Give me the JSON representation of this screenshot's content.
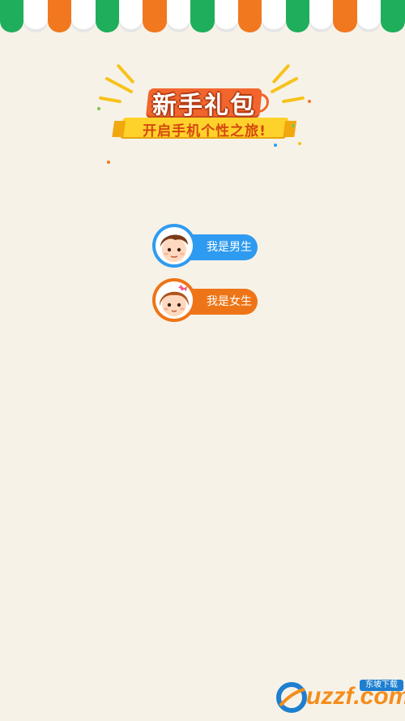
{
  "banner": {
    "title": "新手礼包",
    "subtitle": "开启手机个性之旅!"
  },
  "gender_options": [
    {
      "label": "我是男生",
      "color": "#2f9bf0"
    },
    {
      "label": "我是女生",
      "color": "#ee7517"
    }
  ],
  "footer": {
    "logo_text": "uzzf.com",
    "logo_tag": "东坡下载"
  },
  "colors": {
    "background": "#f7f2e8",
    "awning_green": "#1fae5b",
    "awning_orange": "#f1781f",
    "boy_blue": "#2f9bf0",
    "girl_orange": "#ee7517"
  }
}
